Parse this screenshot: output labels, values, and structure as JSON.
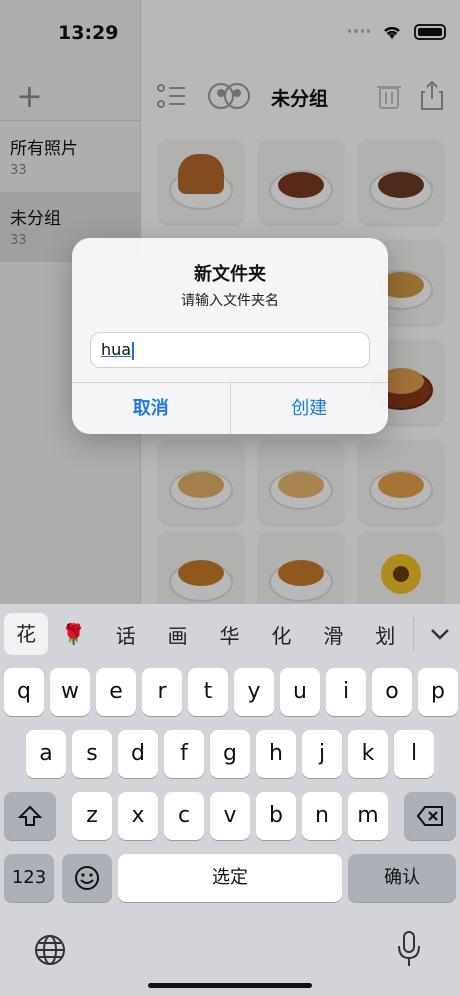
{
  "status": {
    "time": "13:29"
  },
  "sidebar": {
    "add_label": "+",
    "items": [
      {
        "title": "所有照片",
        "count": "33"
      },
      {
        "title": "未分组",
        "count": "33"
      }
    ]
  },
  "toolbar": {
    "title": "未分组"
  },
  "dialog": {
    "title": "新文件夹",
    "message": "请输入文件夹名",
    "input_value": "hua",
    "cancel_label": "取消",
    "create_label": "创建"
  },
  "keyboard": {
    "candidates": [
      "花",
      "🌹",
      "话",
      "画",
      "华",
      "化",
      "滑",
      "划"
    ],
    "row1": [
      "q",
      "w",
      "e",
      "r",
      "t",
      "y",
      "u",
      "i",
      "o",
      "p"
    ],
    "row2": [
      "a",
      "s",
      "d",
      "f",
      "g",
      "h",
      "j",
      "k",
      "l"
    ],
    "row3": [
      "z",
      "x",
      "c",
      "v",
      "b",
      "n",
      "m"
    ],
    "num_label": "123",
    "space_label": "选定",
    "confirm_label": "确认"
  }
}
